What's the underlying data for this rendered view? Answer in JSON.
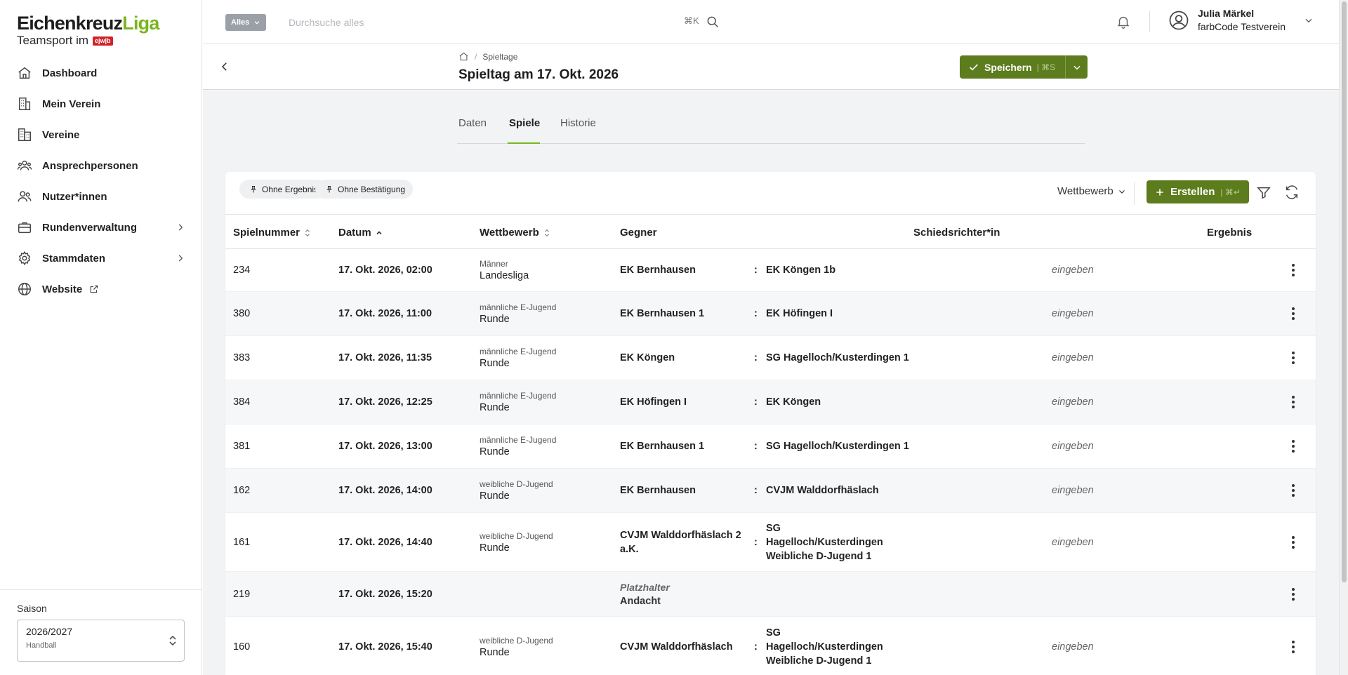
{
  "sidebar": {
    "logo_part1": "Eichenkreuz",
    "logo_part2": "Liga",
    "logo_sub": "Teamsport im",
    "logo_badge": "ejw|b",
    "items": [
      {
        "label": "Dashboard",
        "icon": "home-icon"
      },
      {
        "label": "Mein Verein",
        "icon": "building-icon"
      },
      {
        "label": "Vereine",
        "icon": "buildings-icon"
      },
      {
        "label": "Ansprechpersonen",
        "icon": "people-icon"
      },
      {
        "label": "Nutzer*innen",
        "icon": "users-icon"
      },
      {
        "label": "Rundenverwaltung",
        "icon": "briefcase-icon"
      },
      {
        "label": "Stammdaten",
        "icon": "gear-icon"
      },
      {
        "label": "Website",
        "icon": "globe-icon"
      }
    ],
    "saison_label": "Saison",
    "saison_value": "2026/2027",
    "saison_sub": "Handball"
  },
  "topbar": {
    "scope_label": "Alles",
    "search_placeholder": "Durchsuche alles",
    "search_shortcut": "⌘K",
    "user_name": "Julia Märkel",
    "user_org": "farbCode Testverein"
  },
  "header": {
    "breadcrumb": "Spieltage",
    "title": "Spieltag am 17. Okt. 2026",
    "save_label": "Speichern",
    "save_shortcut": "⌘S"
  },
  "tabs": [
    {
      "label": "Daten",
      "active": false
    },
    {
      "label": "Spiele",
      "active": true
    },
    {
      "label": "Historie",
      "active": false
    }
  ],
  "toolbar": {
    "chip1": "Ohne Ergebnis",
    "chip2": "Ohne Bestätigung",
    "filter_label": "Wettbewerb",
    "create_label": "Erstellen",
    "create_shortcut": "⌘↵"
  },
  "table": {
    "columns": {
      "num": "Spielnummer",
      "date": "Datum",
      "comp": "Wettbewerb",
      "opp": "Gegner",
      "ref": "Schiedsrichter*in",
      "result": "Ergebnis"
    },
    "result_action": "eingeben",
    "rows": [
      {
        "num": "234",
        "date": "17. Okt. 2026, 02:00",
        "comp_group": "Männer",
        "comp_name": "Landesliga",
        "home": "EK Bernhausen",
        "away": "EK Köngen 1b"
      },
      {
        "num": "380",
        "date": "17. Okt. 2026, 11:00",
        "comp_group": "männliche E-Jugend",
        "comp_name": "Runde",
        "home": "EK Bernhausen 1",
        "away": "EK Höfingen I"
      },
      {
        "num": "383",
        "date": "17. Okt. 2026, 11:35",
        "comp_group": "männliche E-Jugend",
        "comp_name": "Runde",
        "home": "EK Köngen",
        "away": "SG Hagelloch/Kusterdingen 1"
      },
      {
        "num": "384",
        "date": "17. Okt. 2026, 12:25",
        "comp_group": "männliche E-Jugend",
        "comp_name": "Runde",
        "home": "EK Höfingen I",
        "away": "EK Köngen"
      },
      {
        "num": "381",
        "date": "17. Okt. 2026, 13:00",
        "comp_group": "männliche E-Jugend",
        "comp_name": "Runde",
        "home": "EK Bernhausen 1",
        "away": "SG Hagelloch/Kusterdingen 1"
      },
      {
        "num": "162",
        "date": "17. Okt. 2026, 14:00",
        "comp_group": "weibliche D-Jugend",
        "comp_name": "Runde",
        "home": "EK Bernhausen",
        "away": "CVJM Walddorfhäslach"
      },
      {
        "num": "161",
        "date": "17. Okt. 2026, 14:40",
        "comp_group": "weibliche D-Jugend",
        "comp_name": "Runde",
        "home": "CVJM Walddorfhäslach 2 a.K.",
        "away": "SG Hagelloch/Kusterdingen Weibliche D-Jugend 1"
      },
      {
        "num": "219",
        "date": "17. Okt. 2026, 15:20",
        "placeholder_label": "Platzhalter",
        "placeholder_name": "Andacht"
      },
      {
        "num": "160",
        "date": "17. Okt. 2026, 15:40",
        "comp_group": "weibliche D-Jugend",
        "comp_name": "Runde",
        "home": "CVJM Walddorfhäslach",
        "away": "SG Hagelloch/Kusterdingen Weibliche D-Jugend 1"
      }
    ]
  },
  "colors": {
    "accent": "#7ab51d",
    "primary_button": "#5c7c1d"
  }
}
